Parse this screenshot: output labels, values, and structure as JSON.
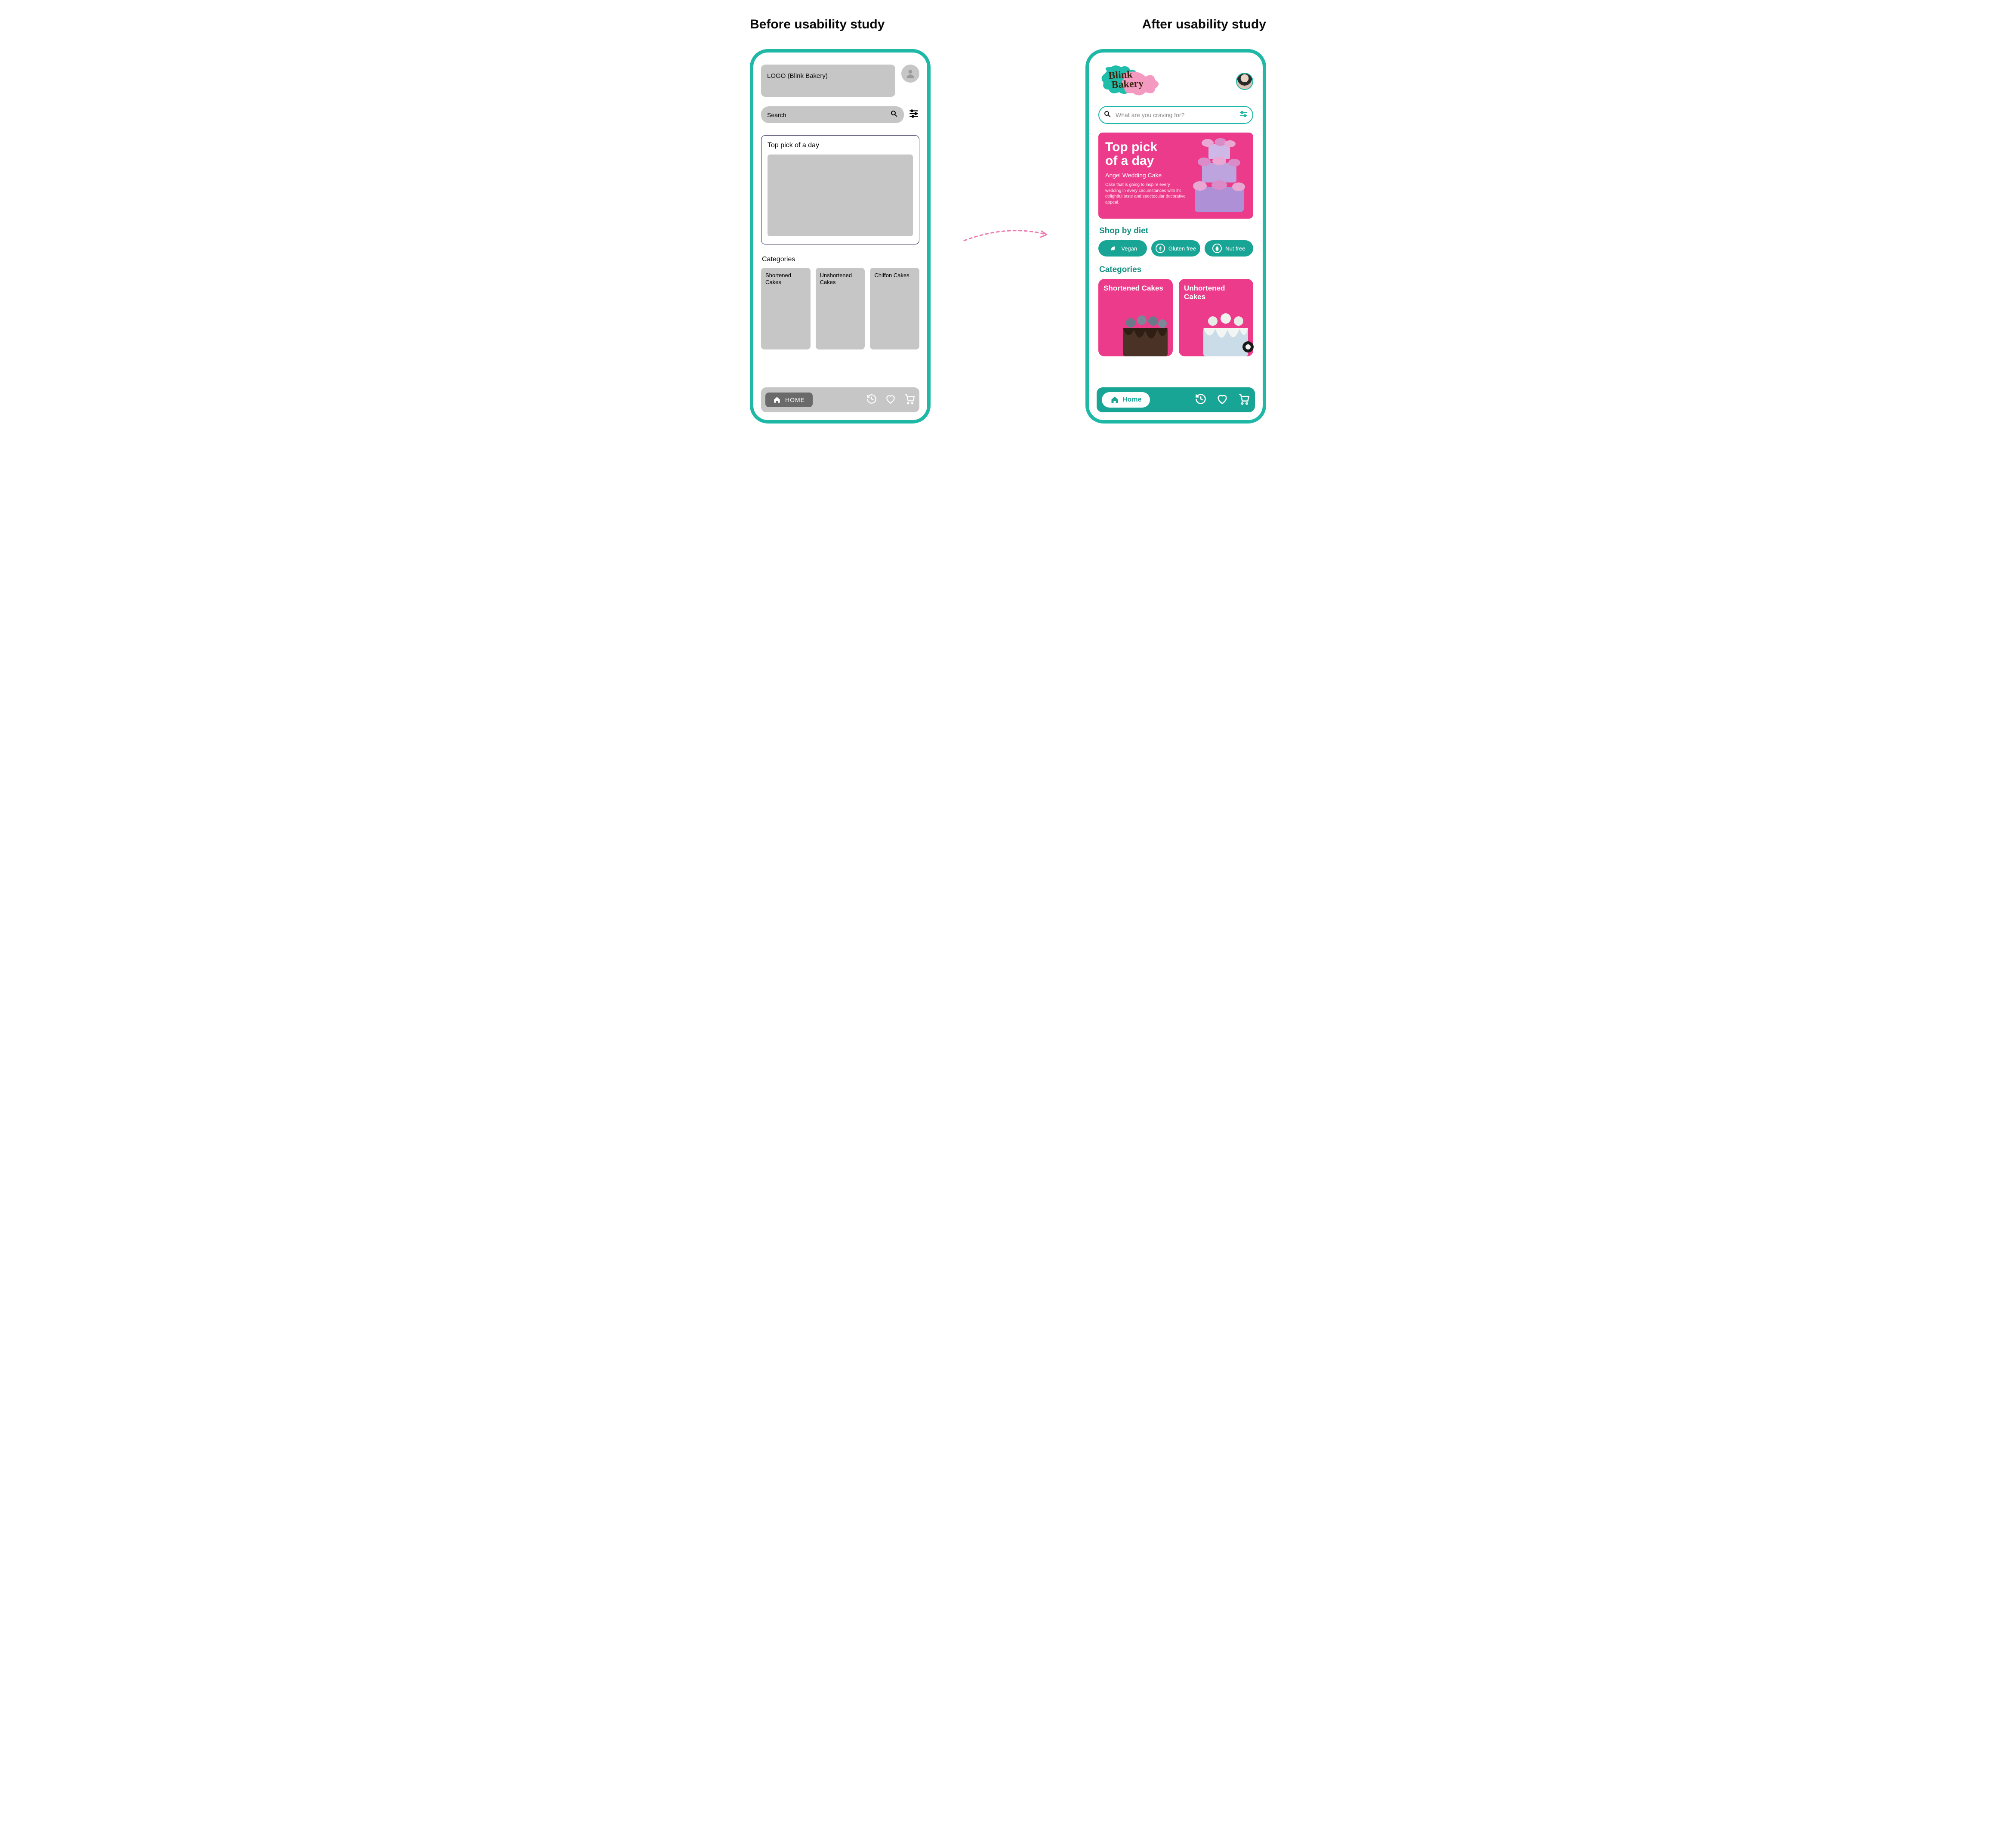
{
  "titles": {
    "before": "Before usability study",
    "after": "After usability study"
  },
  "before": {
    "logo": "LOGO (Blink Bakery)",
    "search_placeholder": "Search",
    "top_pick_title": "Top pick of a day",
    "categories_title": "Categories",
    "categories": [
      "Shortened Cakes",
      "Unshortened Cakes",
      "Chiffon Cakes"
    ],
    "nav_home": "HOME"
  },
  "after": {
    "brand_line1": "Blink",
    "brand_line2": "Bakery",
    "search_placeholder": "What are you craving for?",
    "hero": {
      "title_l1": "Top pick",
      "title_l2": "of a day",
      "subtitle": "Angel Wedding Cake",
      "desc": "Cake that is going to inspire every wedding in every circumstances with it's delightful taste and spectecular decorative appeal."
    },
    "diet_title": "Shop by diet",
    "diets": [
      "Vegan",
      "Gluten free",
      "Nut free"
    ],
    "categories_title": "Categories",
    "categories": [
      "Shortened Cakes",
      "Unhortened Cakes"
    ],
    "nav_home": "Home"
  }
}
